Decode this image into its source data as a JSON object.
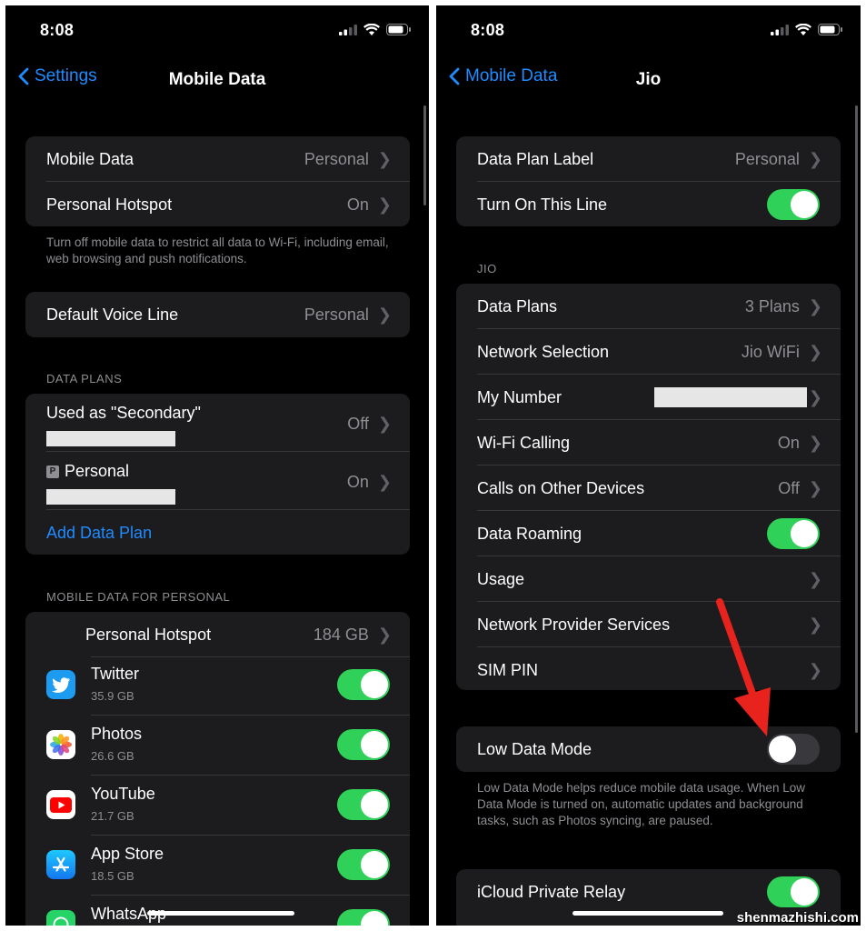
{
  "left": {
    "status": {
      "time": "8:08"
    },
    "nav": {
      "back_label": "Settings",
      "title": "Mobile Data"
    },
    "group1": {
      "mobile_data": {
        "label": "Mobile Data",
        "value": "Personal"
      },
      "hotspot": {
        "label": "Personal Hotspot",
        "value": "On"
      }
    },
    "footer1": "Turn off mobile data to restrict all data to Wi-Fi, including email, web browsing and push notifications.",
    "voice_line": {
      "label": "Default Voice Line",
      "value": "Personal"
    },
    "data_plans_header": "DATA PLANS",
    "plans": [
      {
        "label": "Used as \"Secondary\"",
        "value": "Off"
      },
      {
        "badge": "P",
        "label": "Personal",
        "value": "On"
      }
    ],
    "add_plan": "Add Data Plan",
    "usage_header": "MOBILE DATA FOR PERSONAL",
    "hotspot_usage": {
      "label": "Personal Hotspot",
      "value": "184 GB"
    },
    "apps": [
      {
        "name": "Twitter",
        "size": "35.9 GB"
      },
      {
        "name": "Photos",
        "size": "26.6 GB"
      },
      {
        "name": "YouTube",
        "size": "21.7 GB"
      },
      {
        "name": "App Store",
        "size": "18.5 GB"
      },
      {
        "name": "WhatsApp"
      }
    ]
  },
  "right": {
    "status": {
      "time": "8:08"
    },
    "nav": {
      "back_label": "Mobile Data",
      "title": "Jio"
    },
    "group1": {
      "plan_label": {
        "label": "Data Plan Label",
        "value": "Personal"
      },
      "turn_on_line": {
        "label": "Turn On This Line",
        "on": true
      }
    },
    "section_header": "JIO",
    "rows": {
      "data_plans": {
        "label": "Data Plans",
        "value": "3 Plans"
      },
      "network_selection": {
        "label": "Network Selection",
        "value": "Jio WiFi"
      },
      "my_number": {
        "label": "My Number"
      },
      "wifi_calling": {
        "label": "Wi-Fi Calling",
        "value": "On"
      },
      "calls_other": {
        "label": "Calls on Other Devices",
        "value": "Off"
      },
      "data_roaming": {
        "label": "Data Roaming",
        "on": true
      },
      "usage": {
        "label": "Usage"
      },
      "network_provider": {
        "label": "Network Provider Services"
      },
      "sim_pin": {
        "label": "SIM PIN"
      }
    },
    "low_data": {
      "label": "Low Data Mode",
      "on": false
    },
    "low_data_footer": "Low Data Mode helps reduce mobile data usage. When Low Data Mode is turned on, automatic updates and background tasks, such as Photos syncing, are paused.",
    "icloud_relay": {
      "label": "iCloud Private Relay",
      "on": true
    }
  },
  "watermark": "shenmazhishi.com",
  "colors": {
    "accent": "#1f8bff",
    "toggle_on": "#30d158",
    "arrow": "#e8231d"
  },
  "icons": [
    "chevron-left-icon",
    "chevron-right-icon",
    "signal-icon",
    "wifi-icon",
    "battery-icon",
    "twitter-icon",
    "photos-icon",
    "youtube-icon",
    "app-store-icon",
    "whatsapp-icon"
  ]
}
